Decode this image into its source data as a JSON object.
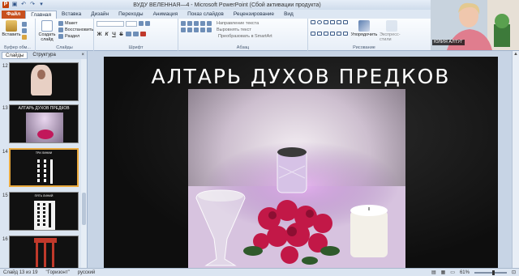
{
  "window": {
    "title": "ВУДУ ВЕЛЕННАЯ—4 - Microsoft PowerPoint (Сбой активации продукта)"
  },
  "quick_access": [
    "save-icon",
    "undo-icon",
    "redo-icon",
    "customize-icon"
  ],
  "ribbon_tabs": [
    {
      "label": "Файл",
      "kind": "file"
    },
    {
      "label": "Главная",
      "kind": "active"
    },
    {
      "label": "Вставка"
    },
    {
      "label": "Дизайн"
    },
    {
      "label": "Переходы"
    },
    {
      "label": "Анимация"
    },
    {
      "label": "Показ слайдов"
    },
    {
      "label": "Рецензирование"
    },
    {
      "label": "Вид"
    }
  ],
  "ribbon": {
    "clipboard": {
      "paste": "Вставить",
      "label": "Буфер обм..."
    },
    "slides": {
      "create": "Создать слайд",
      "layout": "Макет",
      "reset": "Восстановить",
      "section": "Раздел",
      "label": "Слайды"
    },
    "font": {
      "label": "Шрифт",
      "bold": "Ж",
      "italic": "К",
      "underline": "Ч",
      "strike": "S"
    },
    "paragraph": {
      "label": "Абзац",
      "text_direction": "Направление текста",
      "align_text": "Выровнять текст",
      "smartart": "Преобразовать в SmartArt"
    },
    "drawing": {
      "label": "Рисование",
      "arrange": "Упорядочить",
      "quick_styles": "Экспресс-стили"
    }
  },
  "left_panel": {
    "tabs": [
      "Слайды",
      "Структура"
    ],
    "close": "×",
    "thumbnails": [
      {
        "number": "12"
      },
      {
        "number": "13",
        "title": "АЛТАРЬ ДУХОВ ПРЕДКОВ"
      },
      {
        "number": "14",
        "selected": true,
        "title": "ТРИ ЛИНИИ"
      },
      {
        "number": "15",
        "title": "ПЯТЬ ЛИНИЙ"
      },
      {
        "number": "16"
      }
    ]
  },
  "slide": {
    "title": "АЛТАРЬ ДУХОВ ПРЕДКОВ"
  },
  "status_bar": {
    "slide_info": "Слайд 13 из 19",
    "theme": "\"Горизонт\"",
    "language": "русский",
    "zoom": "61%"
  },
  "webcam": {
    "label": "ЮЛИЯ АЛТУГ"
  }
}
